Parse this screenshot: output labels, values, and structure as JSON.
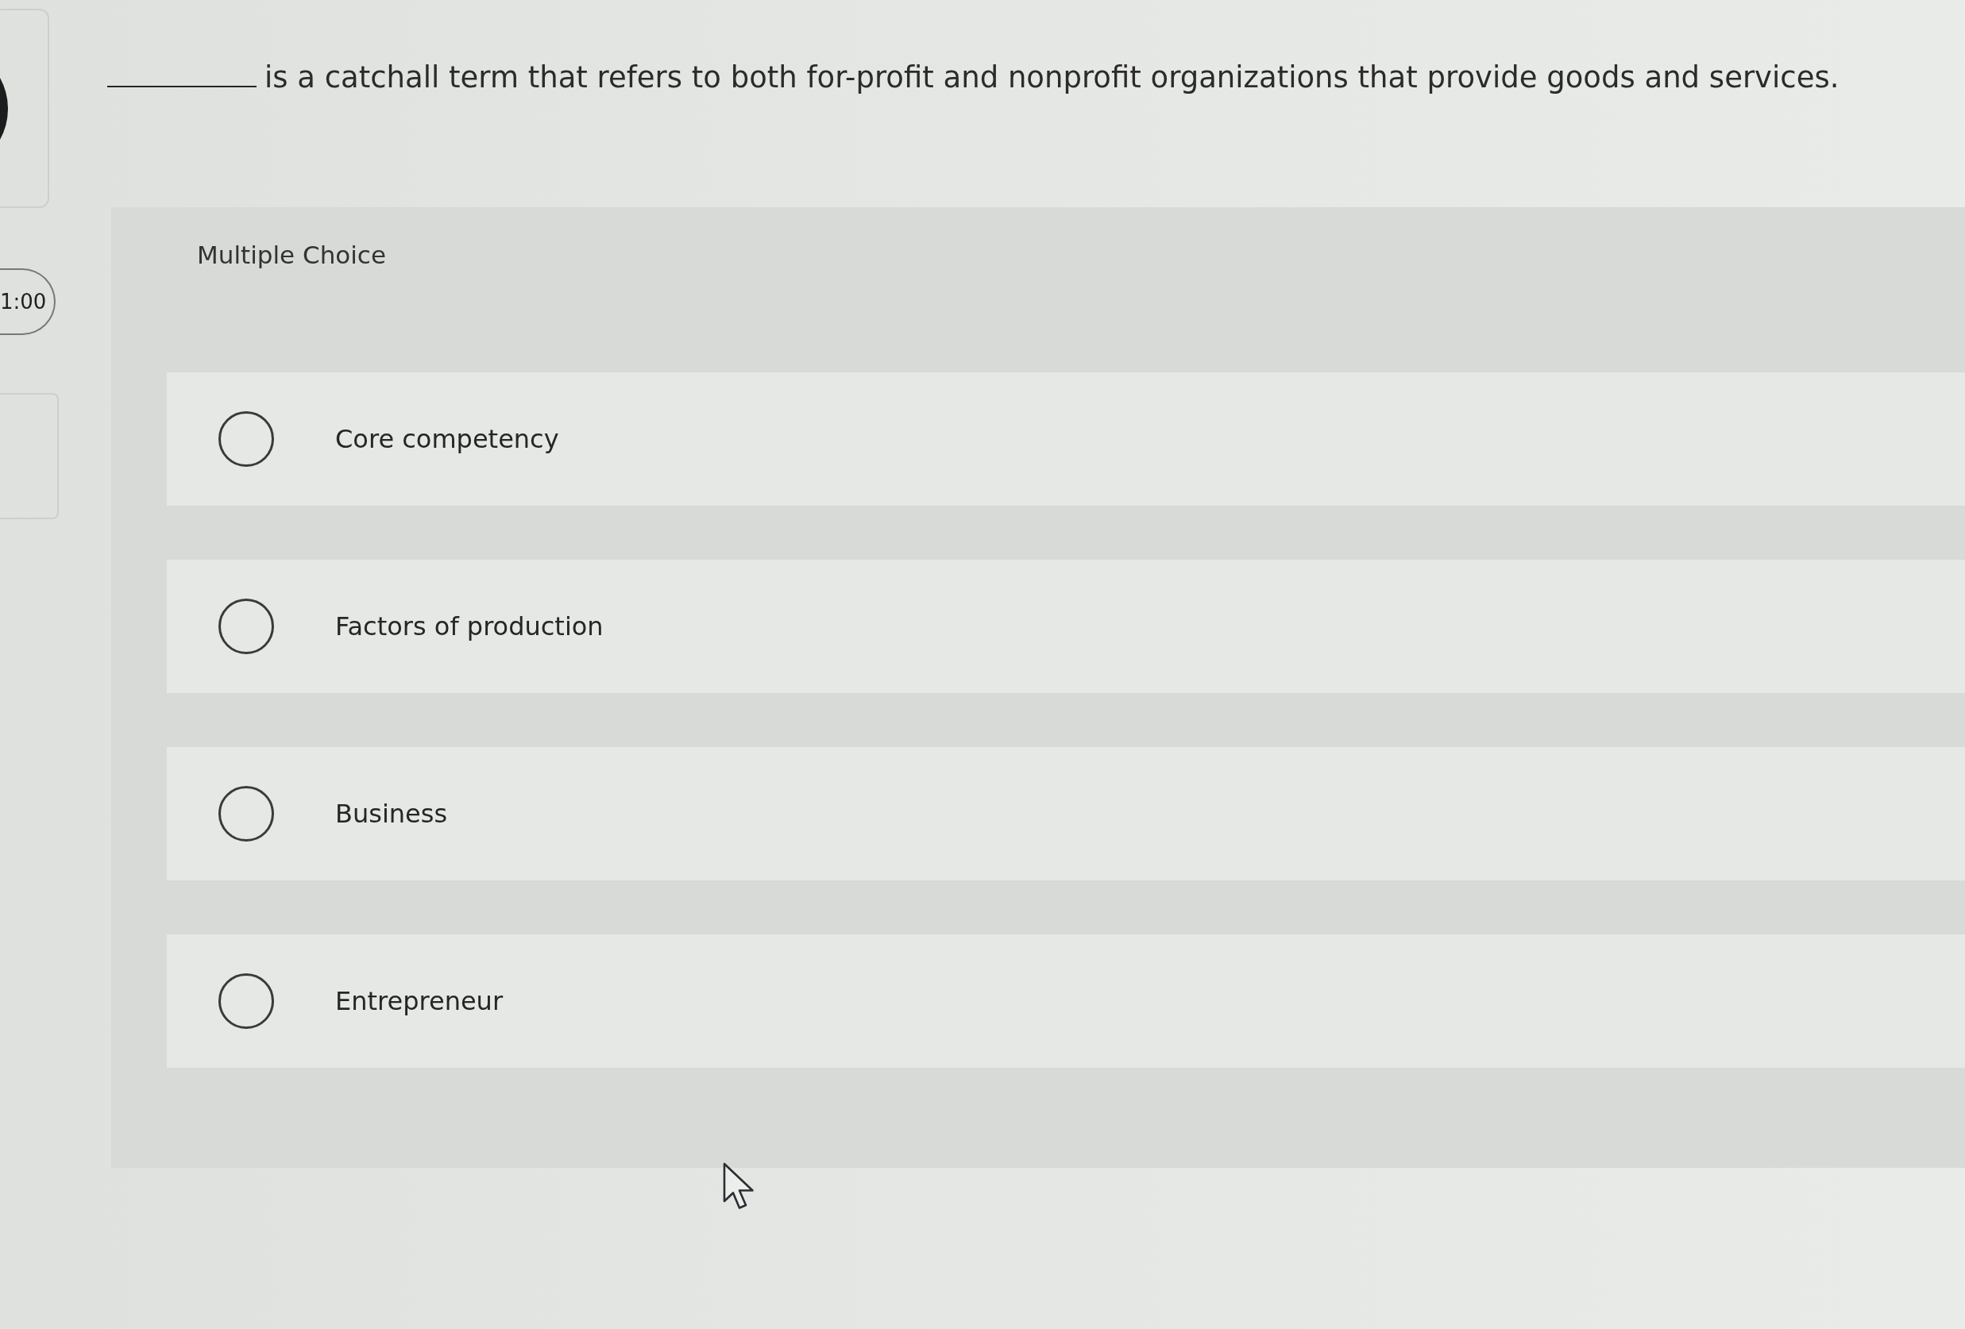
{
  "sidebar": {
    "timer": "1:00"
  },
  "question": {
    "text": "is a catchall term that refers to both for-profit and nonprofit organizations that provide goods and services."
  },
  "answer_panel": {
    "heading": "Multiple Choice",
    "options": [
      {
        "label": "Core competency",
        "selected": false
      },
      {
        "label": "Factors of production",
        "selected": false
      },
      {
        "label": "Business",
        "selected": false
      },
      {
        "label": "Entrepreneur",
        "selected": false
      }
    ]
  }
}
